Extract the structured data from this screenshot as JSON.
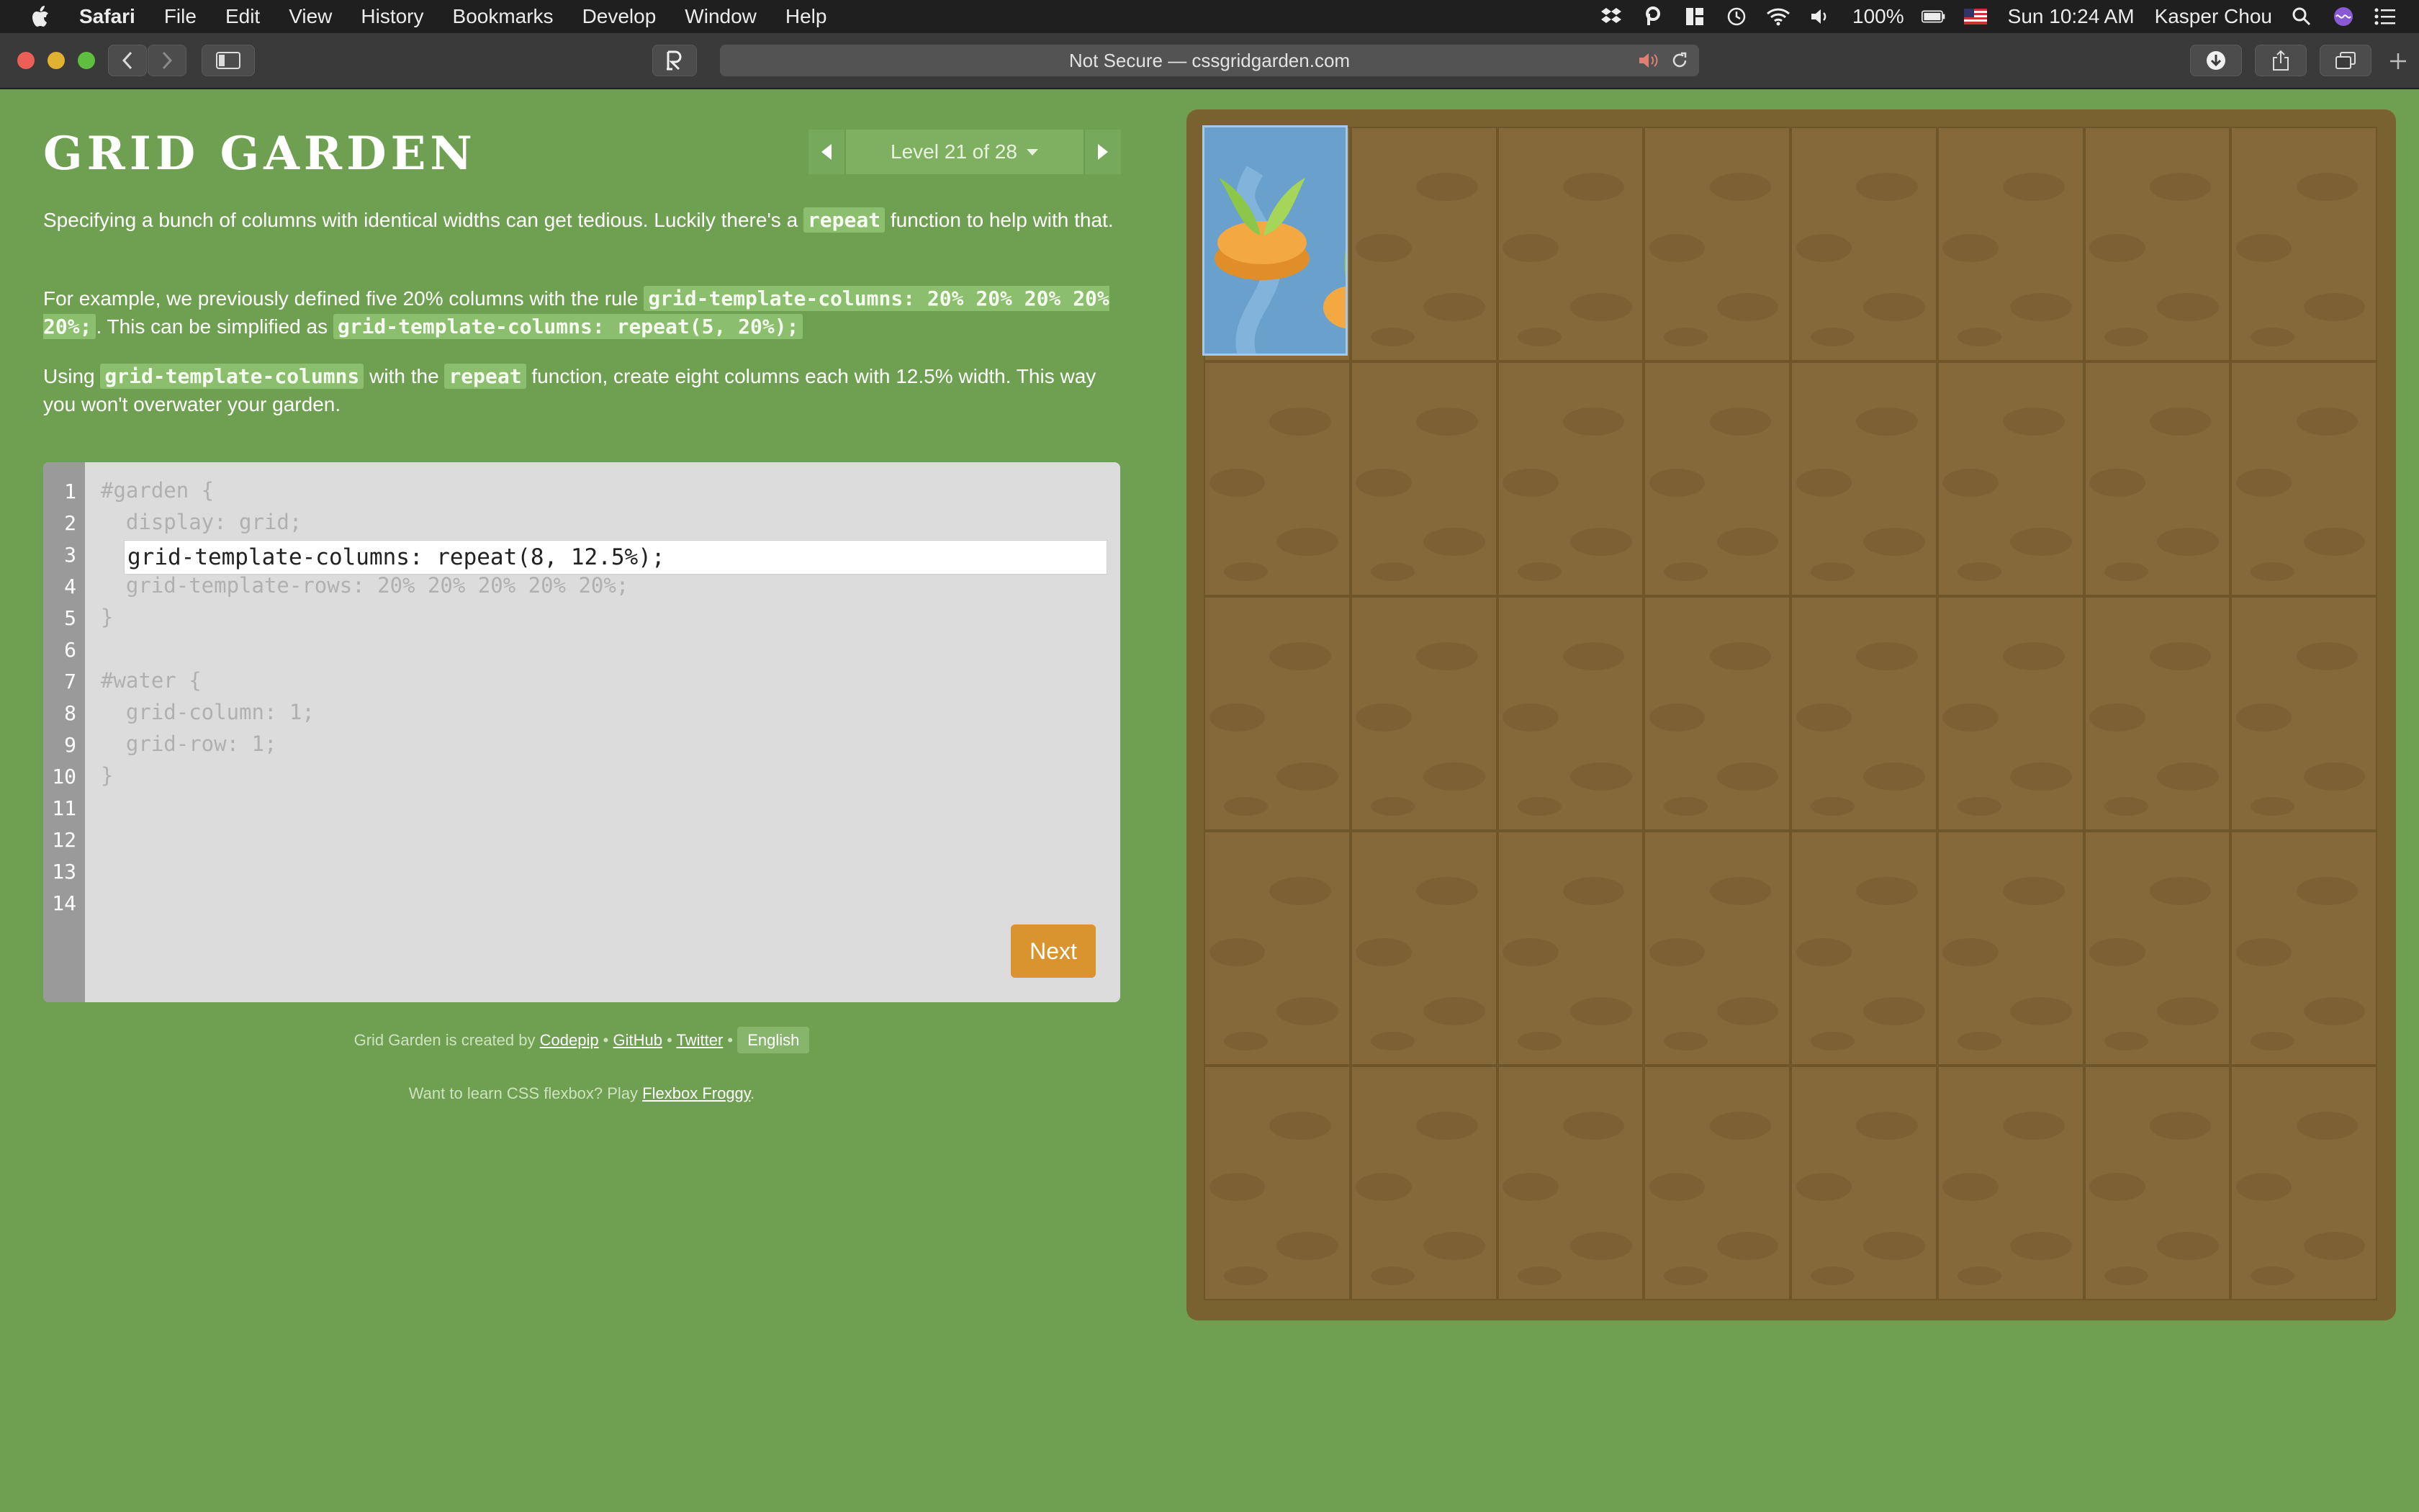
{
  "menubar": {
    "app": "Safari",
    "menus": [
      "File",
      "Edit",
      "View",
      "History",
      "Bookmarks",
      "Develop",
      "Window",
      "Help"
    ],
    "battery": "100%",
    "clock": "Sun 10:24 AM",
    "user": "Kasper Chou"
  },
  "browser": {
    "address": "Not Secure — cssgridgarden.com"
  },
  "page": {
    "title": "GRID GARDEN",
    "level_label": "Level 21 of 28",
    "para1_a": "Specifying a bunch of columns with identical widths can get tedious. Luckily there's a ",
    "para1_code": "repeat",
    "para1_b": " function to help with that.",
    "para2_a": "For example, we previously defined five 20% columns with the rule ",
    "para2_code1": "grid-template-columns: 20% 20% 20% 20% 20%;",
    "para2_b": ". This can be simplified as ",
    "para2_code2": "grid-template-columns: repeat(5, 20%);",
    "para3_a": "Using ",
    "para3_code1": "grid-template-columns",
    "para3_b": " with the ",
    "para3_code2": "repeat",
    "para3_c": " function, create eight columns each with 12.5% width. This way you won't overwater your garden.",
    "next_label": "Next"
  },
  "editor": {
    "line_numbers": [
      "1",
      "2",
      "3",
      "4",
      "5",
      "6",
      "7",
      "8",
      "9",
      "10",
      "11",
      "12",
      "13",
      "14"
    ],
    "lines": {
      "l1": "#garden {",
      "l2": "  display: grid;",
      "l4": "  grid-template-rows: 20% 20% 20% 20% 20%;",
      "l5": "}",
      "l7": "#water {",
      "l8": "  grid-column: 1;",
      "l9": "  grid-row: 1;",
      "l10": "}"
    },
    "answer_value": "grid-template-columns: repeat(8, 12.5%);"
  },
  "footer": {
    "created_by": "Grid Garden is created by ",
    "codepip": "Codepip",
    "github": "GitHub",
    "twitter": "Twitter",
    "sep": " • ",
    "language": "English",
    "learn_prefix": "Want to learn CSS flexbox? Play ",
    "flexbox_froggy": "Flexbox Froggy",
    "learn_suffix": "."
  },
  "garden": {
    "columns": 8,
    "rows": 5,
    "water_column": 1,
    "water_row": 1
  },
  "colors": {
    "page_bg": "#6fa052",
    "soil": "#86693b",
    "water": "#6aa0cc",
    "next_button": "#d9932f"
  }
}
